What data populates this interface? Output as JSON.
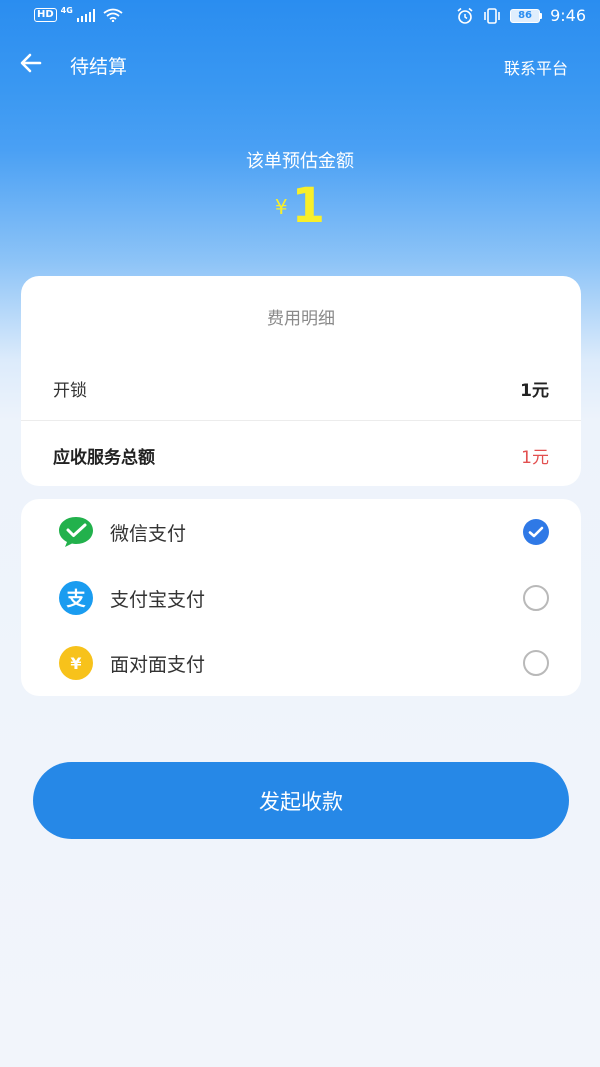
{
  "status_bar": {
    "hd": "HD",
    "network": "4G",
    "battery": "86",
    "time": "9:46"
  },
  "nav": {
    "title": "待结算",
    "contact": "联系平台"
  },
  "amount": {
    "label": "该单预估金额",
    "currency": "¥",
    "value": "1"
  },
  "fee_detail": {
    "title": "费用明细",
    "rows": [
      {
        "label": "开锁",
        "value": "1元"
      },
      {
        "label": "应收服务总额",
        "value": "1元"
      }
    ]
  },
  "payment": {
    "options": [
      {
        "label": "微信支付",
        "icon": "wechat-pay-icon",
        "color": "#22b14c",
        "selected": true
      },
      {
        "label": "支付宝支付",
        "icon": "alipay-icon",
        "color": "#1a9cf0",
        "selected": false
      },
      {
        "label": "面对面支付",
        "icon": "face-to-face-pay-icon",
        "color": "#f7c21b",
        "selected": false
      }
    ]
  },
  "submit_label": "发起收款",
  "colors": {
    "primary": "#2688e7",
    "amount": "#f8ef2a",
    "total_value": "#e25050",
    "radio_selected": "#2f79e6"
  }
}
